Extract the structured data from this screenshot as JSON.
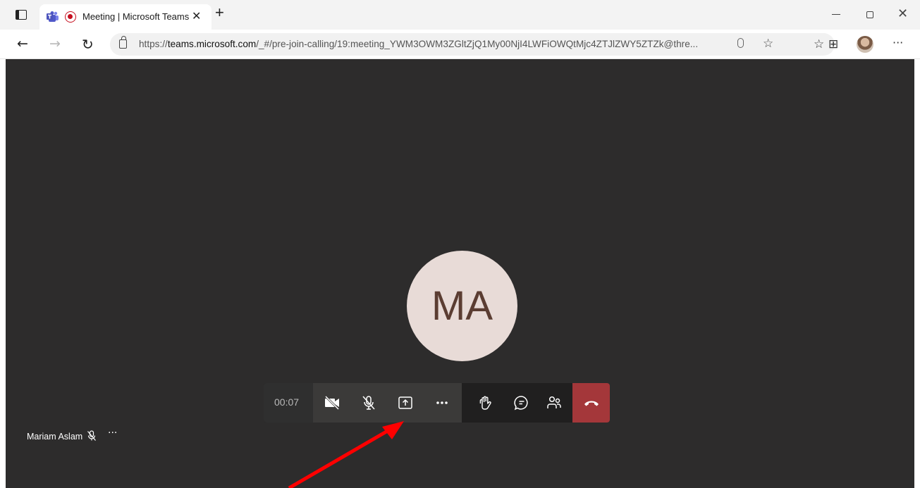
{
  "browser": {
    "tab_title": "Meeting | Microsoft Teams",
    "tab_close": "✕",
    "new_tab": "+",
    "url_prefix": "https://",
    "url_domain": "teams.microsoft.com",
    "url_path": "/_#/pre-join-calling/19:meeting_YWM3OWM3ZGltZjQ1My00NjI4LWFiOWQtMjc4ZTJlZWY5ZTZk@thre...",
    "window_controls": [
      "minimize",
      "maximize",
      "close"
    ]
  },
  "meeting": {
    "avatar_initials": "MA",
    "timer": "00:07",
    "participant_name": "Mariam Aslam",
    "controls": [
      "camera-off",
      "mic-off",
      "share",
      "more",
      "raise-hand",
      "chat",
      "participants",
      "hang-up"
    ]
  },
  "colors": {
    "stage_bg": "#2d2c2c",
    "avatar_bg": "#e8dbd7",
    "avatar_text": "#5b3d32",
    "hangup_bg": "#a4373a",
    "annotation_arrow": "#ff0000"
  }
}
